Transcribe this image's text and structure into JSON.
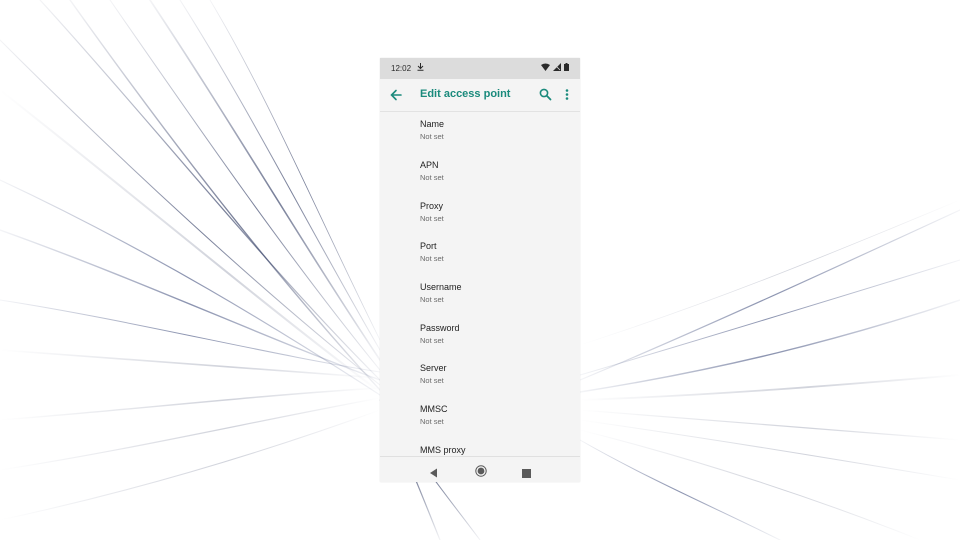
{
  "status_bar": {
    "time": "12:02",
    "icons": [
      "download-icon",
      "wifi-icon",
      "signal-icon",
      "battery-icon"
    ]
  },
  "app_bar": {
    "title": "Edit access point",
    "actions": [
      "back-arrow-icon",
      "search-icon",
      "more-vert-icon"
    ]
  },
  "settings": [
    {
      "title": "Name",
      "summary": "Not set"
    },
    {
      "title": "APN",
      "summary": "Not set"
    },
    {
      "title": "Proxy",
      "summary": "Not set"
    },
    {
      "title": "Port",
      "summary": "Not set"
    },
    {
      "title": "Username",
      "summary": "Not set"
    },
    {
      "title": "Password",
      "summary": "Not set"
    },
    {
      "title": "Server",
      "summary": "Not set"
    },
    {
      "title": "MMSC",
      "summary": "Not set"
    },
    {
      "title": "MMS proxy",
      "summary": ""
    }
  ],
  "nav_bar": {
    "buttons": [
      "nav-back-icon",
      "nav-home-icon",
      "nav-recents-icon"
    ]
  },
  "colors": {
    "accent": "#1a8a7c",
    "background": "#f4f4f4",
    "status_bar": "#dcdcdc",
    "wallpaper_streak": "#2b3a6e"
  }
}
